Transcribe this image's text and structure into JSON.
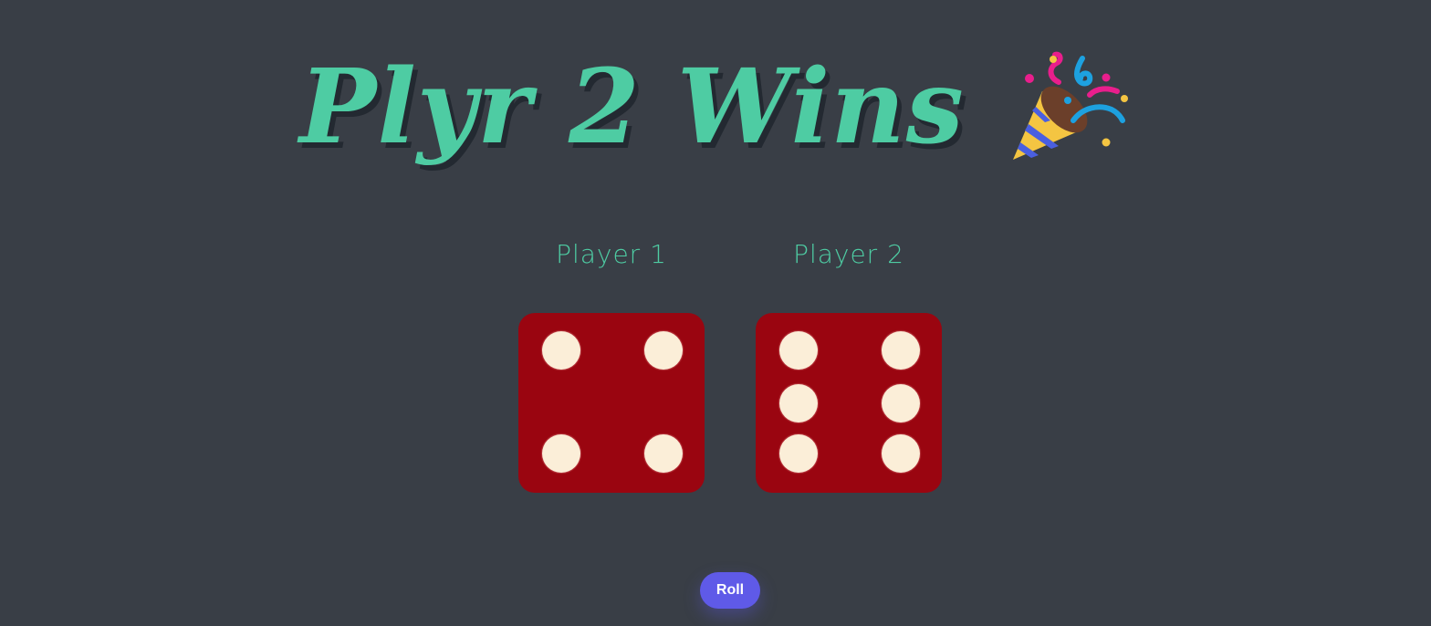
{
  "title": {
    "text": "Plyr 2 Wins",
    "icon": "party-popper-icon"
  },
  "players": [
    {
      "label": "Player 1",
      "die_value": 4
    },
    {
      "label": "Player 2",
      "die_value": 6
    }
  ],
  "roll_button": {
    "label": "Roll"
  },
  "colors": {
    "background": "#393e46",
    "accent": "#4ecca3",
    "die_face": "#9a0510",
    "pip": "#fbeed8",
    "button": "#5f5ae8"
  }
}
